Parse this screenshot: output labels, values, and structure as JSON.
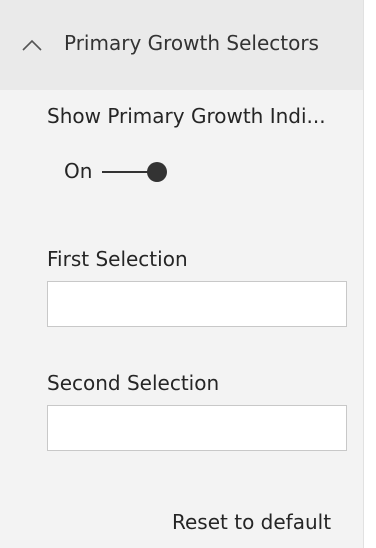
{
  "section": {
    "title": "Primary Growth Selectors",
    "expanded": true
  },
  "show_indicator": {
    "label": "Show Primary Growth Indi...",
    "state_label": "On",
    "value": true
  },
  "first_selection": {
    "label": "First Selection",
    "value": ""
  },
  "second_selection": {
    "label": "Second Selection",
    "value": ""
  },
  "reset": {
    "label": "Reset to default"
  },
  "colors": {
    "pane_background": "#f3f3f3",
    "header_background": "#eaeaea",
    "toggle_on": "#333333",
    "text": "#252525"
  }
}
